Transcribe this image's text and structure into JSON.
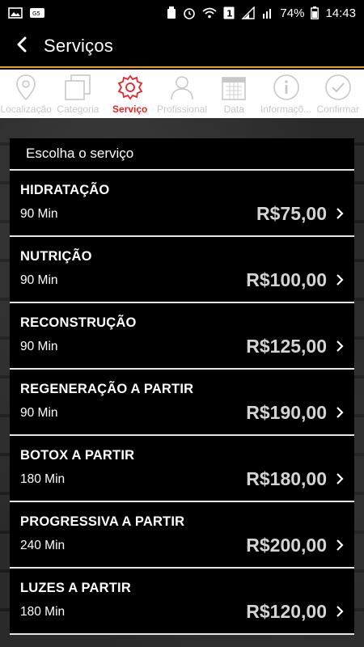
{
  "status_bar": {
    "battery": "74%",
    "time": "14:43",
    "notification_count": "1"
  },
  "app_bar": {
    "title": "Serviços",
    "back_icon": "back-arrow-icon"
  },
  "steps": [
    {
      "label": "Localização",
      "icon": "location-pin-icon",
      "active": false
    },
    {
      "label": "Categoria",
      "icon": "category-icon",
      "active": false
    },
    {
      "label": "Serviço",
      "icon": "gear-icon",
      "active": true
    },
    {
      "label": "Profissional",
      "icon": "person-icon",
      "active": false
    },
    {
      "label": "Data",
      "icon": "calendar-icon",
      "active": false
    },
    {
      "label": "Informaçõ...",
      "icon": "info-icon",
      "active": false
    },
    {
      "label": "Confirmar",
      "icon": "check-circle-icon",
      "active": false
    }
  ],
  "panel": {
    "header": "Escolha o serviço"
  },
  "services": [
    {
      "name": "HIDRATAÇÃO",
      "duration": "90 Min",
      "price": "R$75,00"
    },
    {
      "name": "NUTRIÇÃO",
      "duration": "90 Min",
      "price": "R$100,00"
    },
    {
      "name": "RECONSTRUÇÃO",
      "duration": "90 Min",
      "price": "R$125,00"
    },
    {
      "name": "REGENERAÇÃO A PARTIR",
      "duration": "90 Min",
      "price": "R$190,00"
    },
    {
      "name": "BOTOX A PARTIR",
      "duration": "180 Min",
      "price": "R$180,00"
    },
    {
      "name": "PROGRESSIVA A PARTIR",
      "duration": "240 Min",
      "price": "R$200,00"
    },
    {
      "name": "LUZES A PARTIR",
      "duration": "180 Min",
      "price": "R$120,00"
    }
  ],
  "colors": {
    "accent_active": "#e8242a",
    "appbar_border": "#f29a1d",
    "inactive_step": "#c8c8c8"
  }
}
